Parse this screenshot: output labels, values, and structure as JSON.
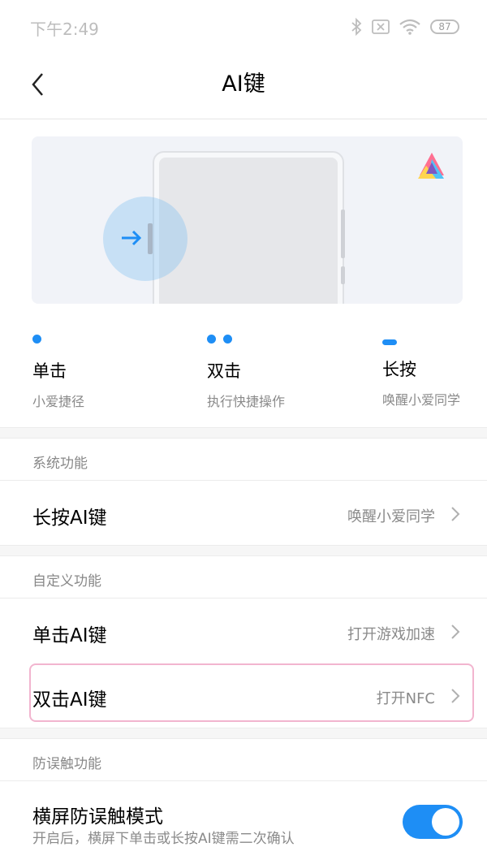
{
  "status_bar": {
    "time": "下午2:49",
    "battery": "87",
    "icons": [
      "bluetooth-icon",
      "sim-off-icon",
      "wifi-icon",
      "battery-icon"
    ]
  },
  "header": {
    "title": "AI键",
    "back_icon": "back-chevron-icon"
  },
  "illustration": {
    "icon": "xiaoai-logo-icon",
    "accent_color": "#1e8ef5"
  },
  "press_modes": [
    {
      "indicator": "single-dot",
      "title": "单击",
      "desc": "小爱捷径"
    },
    {
      "indicator": "double-dot",
      "title": "双击",
      "desc": "执行快捷操作"
    },
    {
      "indicator": "dash",
      "title": "长按",
      "desc": "唤醒小爱同学"
    }
  ],
  "sections": {
    "system": {
      "title": "系统功能",
      "rows": [
        {
          "label": "长按AI键",
          "value": "唤醒小爱同学"
        }
      ]
    },
    "custom": {
      "title": "自定义功能",
      "rows": [
        {
          "label": "单击AI键",
          "value": "打开游戏加速"
        },
        {
          "label": "双击AI键",
          "value": "打开NFC"
        }
      ]
    },
    "anti_mistouch": {
      "title": "防误触功能",
      "rows": [
        {
          "label": "横屏防误触模式",
          "desc": "开启后，横屏下单击或长按AI键需二次确认",
          "toggle_on": true
        }
      ]
    }
  },
  "colors": {
    "accent": "#1e8ef5",
    "highlight_border": "#f2b5cf"
  }
}
